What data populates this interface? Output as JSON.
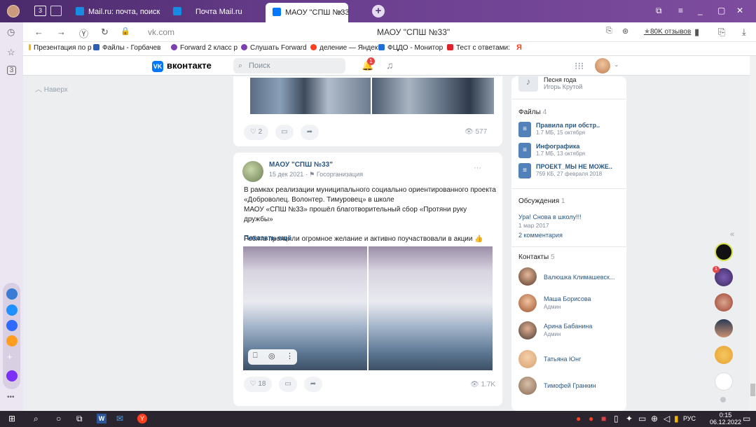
{
  "browser": {
    "tabs": [
      {
        "label": "Mail.ru: почта, поиск в ин",
        "fav_color": "#168de2"
      },
      {
        "label": "Почта Mail.ru",
        "fav_color": "#168de2"
      },
      {
        "label": "МАОУ \"СПШ №33\"",
        "fav_color": "#0077ff"
      }
    ],
    "tabs_count_icon": "3",
    "url": "vk.com",
    "page_title": "МАОУ \"СПШ №33\"",
    "reviews": "80K отзывов",
    "bookmarks": [
      {
        "label": "Презентация по р",
        "color": "#f2b705"
      },
      {
        "label": "Файлы - Горбачев",
        "color": "#2b5fb5"
      },
      {
        "label": "Forward 2 класс р",
        "color": "#7b3fb0"
      },
      {
        "label": "Слушать Forward",
        "color": "#7b3fb0"
      },
      {
        "label": "деление — Яндек",
        "color": "#fc3f1d"
      },
      {
        "label": "ФЦДО - Монитор",
        "color": "#1e6fd9"
      },
      {
        "label": "Тест с ответами:",
        "color": "#e0202a"
      },
      {
        "label": "Я",
        "color": "#fc3f1d"
      }
    ]
  },
  "vk": {
    "brand": "вконтакте",
    "search_placeholder": "Поиск",
    "notif_count": "1",
    "nav_top": "Наверх"
  },
  "post1": {
    "likes": "2",
    "views": "577"
  },
  "post2": {
    "author": "МАОУ \"СПШ №33\"",
    "date": "15 дек 2021",
    "type": "Госорганизация",
    "text_lines": [
      "В рамках реализации муниципального социально ориентированного проекта",
      "«Доброволец. Волонтер. Тимуровец» в школе",
      "МАОУ «СПШ №33» прошёл благотворительный сбор «Протяни руку дружбы»",
      "",
      "Ребята проявили огромное желание и активно поучаствовали в акции"
    ],
    "show_more": "Показать ещё",
    "likes": "18",
    "views": "1.7K"
  },
  "sidebar": {
    "music_artist": "Игорь Крутой",
    "music_title": "Песня года",
    "files_label": "Файлы",
    "files_count": "4",
    "files": [
      {
        "title": "Правила при обстр..",
        "meta": "1.7 МБ, 15 октября"
      },
      {
        "title": "Инфографика",
        "meta": "1.7 МБ, 13 октября"
      },
      {
        "title": "ПРОЕКТ_МЫ НЕ МОЖЕ..",
        "meta": "759 КБ, 27 февраля 2018"
      }
    ],
    "discussions_label": "Обсуждения",
    "discussions_count": "1",
    "discussion_title": "Ура! Снова в школу!!!",
    "discussion_date": "1 мар 2017",
    "discussion_comments": "2 комментария",
    "contacts_label": "Контакты",
    "contacts_count": "5",
    "contacts": [
      {
        "name": "Валюшка Климашевск...",
        "role": "",
        "color": "#5a3a2a"
      },
      {
        "name": "Маша Борисова",
        "role": "Админ",
        "color": "#a0522d"
      },
      {
        "name": "Арина Бабанина",
        "role": "Админ",
        "color": "#4a3a35"
      },
      {
        "name": "Татьяна Юнг",
        "role": "",
        "color": "#d8a070"
      },
      {
        "name": "Тимофей Гранкин",
        "role": "",
        "color": "#8a6a55"
      }
    ]
  },
  "taskbar": {
    "lang": "РУС",
    "time": "0:15",
    "date": "06.12.2022"
  }
}
